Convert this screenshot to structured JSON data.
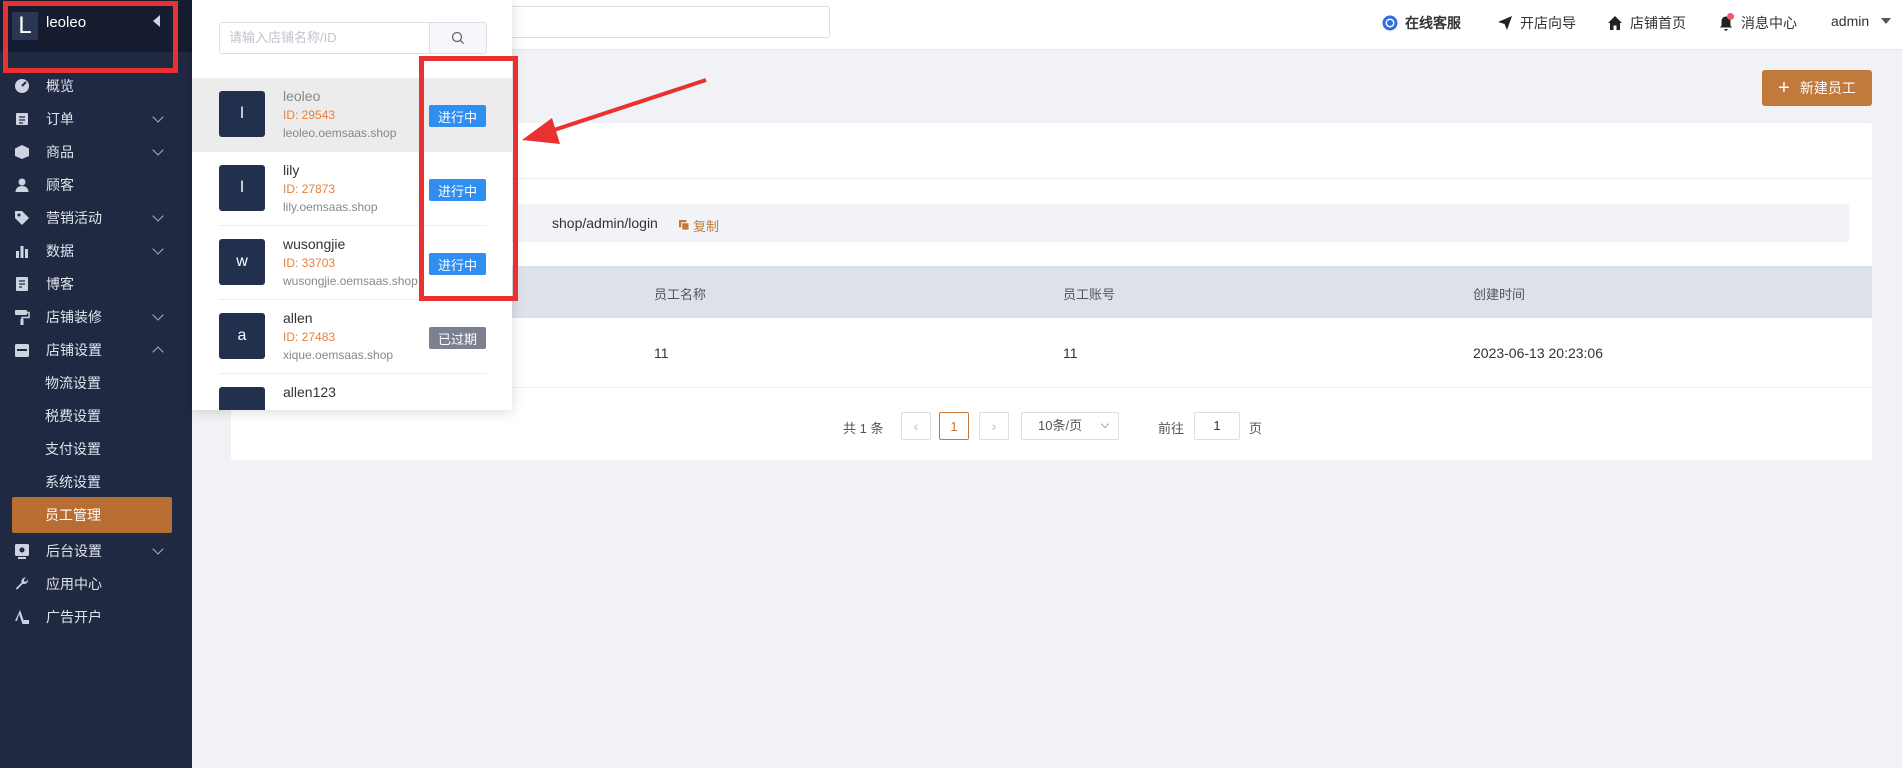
{
  "sidebar": {
    "store_letter": "L",
    "store_name": "leoleo",
    "menu": [
      {
        "label": "概览"
      },
      {
        "label": "订单"
      },
      {
        "label": "商品"
      },
      {
        "label": "顾客"
      },
      {
        "label": "营销活动"
      },
      {
        "label": "数据"
      },
      {
        "label": "博客"
      },
      {
        "label": "店铺装修"
      },
      {
        "label": "店铺设置"
      },
      {
        "label": "后台设置"
      },
      {
        "label": "应用中心"
      },
      {
        "label": "广告开户"
      }
    ],
    "submenu": [
      {
        "label": "物流设置"
      },
      {
        "label": "税费设置"
      },
      {
        "label": "支付设置"
      },
      {
        "label": "系统设置"
      },
      {
        "label": "员工管理"
      }
    ]
  },
  "topbar": {
    "online_service": "在线客服",
    "open_guide": "开店向导",
    "store_home": "店铺首页",
    "messages": "消息中心",
    "user": "admin"
  },
  "main": {
    "new_button": "新建员工",
    "login_url": "shop/admin/login",
    "copy_label": "复制",
    "columns": [
      "员工名称",
      "员工账号",
      "创建时间"
    ],
    "rows": [
      {
        "name": "11",
        "account": "11",
        "created": "2023-06-13 20:23:06"
      }
    ],
    "pager": {
      "total": "共 1 条",
      "current": "1",
      "page_size": "10条/页",
      "goto": "前往",
      "goto_value": "1",
      "unit": "页"
    }
  },
  "store_panel": {
    "search_placeholder": "请输入店铺名称/ID",
    "stores": [
      {
        "avatar": "l",
        "name": "leoleo",
        "id": "ID: 29543",
        "domain": "leoleo.oemsaas.shop",
        "status": "进行中",
        "active": true
      },
      {
        "avatar": "l",
        "name": "lily",
        "id": "ID: 27873",
        "domain": "lily.oemsaas.shop",
        "status": "进行中",
        "active": true
      },
      {
        "avatar": "w",
        "name": "wusongjie",
        "id": "ID: 33703",
        "domain": "wusongjie.oemsaas.shop",
        "status": "进行中",
        "active": true
      },
      {
        "avatar": "a",
        "name": "allen",
        "id": "ID: 27483",
        "domain": "xique.oemsaas.shop",
        "status": "已过期",
        "active": false
      },
      {
        "avatar": "",
        "name": "allen123",
        "id": "",
        "domain": "",
        "status": "",
        "active": false
      }
    ]
  },
  "colors": {
    "sidebar_bg": "#202942",
    "accent": "#c17a3b",
    "status_active": "#2f8ef0",
    "status_expired": "#7d8090",
    "annotation": "#ea3131"
  }
}
